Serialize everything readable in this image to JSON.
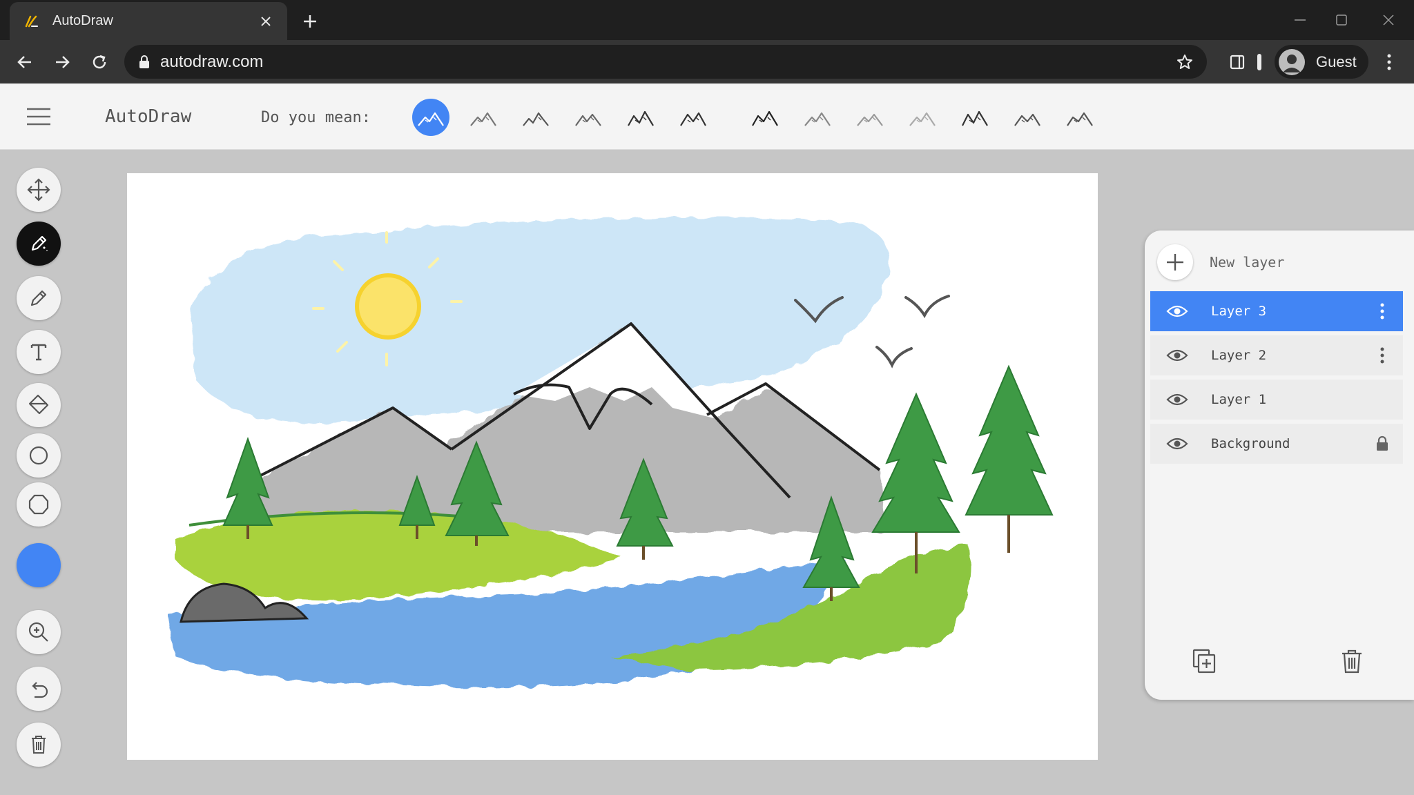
{
  "browser": {
    "tab_title": "AutoDraw",
    "url": "autodraw.com",
    "profile_name": "Guest"
  },
  "app": {
    "title": "AutoDraw",
    "suggestions_label": "Do you mean:",
    "suggestion_count": 13,
    "selected_suggestion": 0,
    "selected_color": "#4285f4"
  },
  "tools": [
    {
      "icon": "move-icon",
      "active": false
    },
    {
      "icon": "autodraw-icon",
      "active": true
    },
    {
      "icon": "pencil-icon",
      "active": false
    },
    {
      "icon": "text-icon",
      "active": false
    },
    {
      "icon": "fill-icon",
      "active": false
    },
    {
      "icon": "circle-icon",
      "active": false
    },
    {
      "icon": "shape-icon",
      "active": false
    },
    {
      "icon": "zoom-icon",
      "active": false
    },
    {
      "icon": "undo-icon",
      "active": false
    },
    {
      "icon": "trash-icon",
      "active": false
    }
  ],
  "layers_panel": {
    "new_layer_label": "New layer",
    "layers": [
      {
        "name": "Layer 3",
        "selected": true,
        "locked": false
      },
      {
        "name": "Layer 2",
        "selected": false,
        "locked": false
      },
      {
        "name": "Layer 1",
        "selected": false,
        "locked": false
      },
      {
        "name": "Background",
        "selected": false,
        "locked": true
      }
    ]
  }
}
